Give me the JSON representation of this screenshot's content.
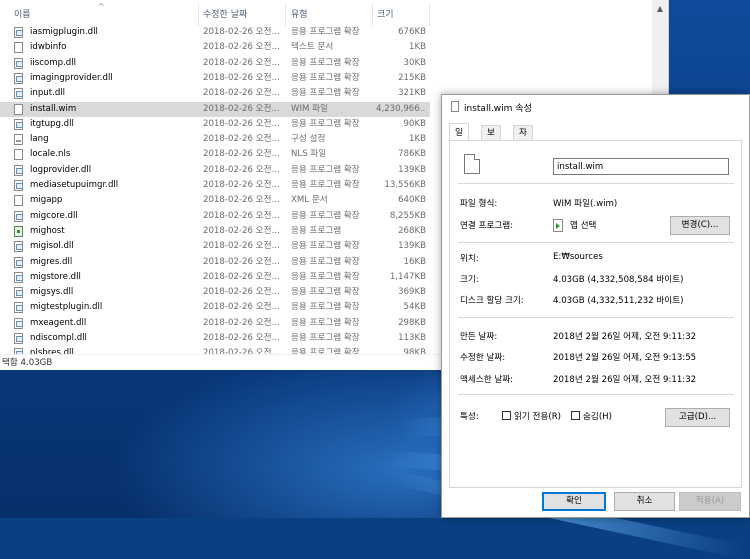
{
  "explorer": {
    "columns": {
      "name": "이름",
      "date": "수정한 날짜",
      "type": "유형",
      "size": "크기"
    },
    "rows": [
      {
        "name": "iasmigplugin.dll",
        "date": "2018-02-26 오전...",
        "type": "응용 프로그램 확장",
        "size": "676KB",
        "icon": "dll-file-icon"
      },
      {
        "name": "idwbinfo",
        "date": "2018-02-26 오전...",
        "type": "텍스트 문서",
        "size": "1KB",
        "icon": "text-file-icon"
      },
      {
        "name": "iiscomp.dll",
        "date": "2018-02-26 오전...",
        "type": "응용 프로그램 확장",
        "size": "30KB",
        "icon": "dll-file-icon"
      },
      {
        "name": "imagingprovider.dll",
        "date": "2018-02-26 오전...",
        "type": "응용 프로그램 확장",
        "size": "215KB",
        "icon": "dll-file-icon"
      },
      {
        "name": "input.dll",
        "date": "2018-02-26 오전...",
        "type": "응용 프로그램 확장",
        "size": "321KB",
        "icon": "dll-file-icon"
      },
      {
        "name": "install.wim",
        "date": "2018-02-26 오전...",
        "type": "WIM 파일",
        "size": "4,230,966...",
        "icon": "generic-file-icon",
        "selected": true
      },
      {
        "name": "itgtupg.dll",
        "date": "2018-02-26 오전...",
        "type": "응용 프로그램 확장",
        "size": "90KB",
        "icon": "dll-file-icon"
      },
      {
        "name": "lang",
        "date": "2018-02-26 오전...",
        "type": "구성 설정",
        "size": "1KB",
        "icon": "config-file-icon"
      },
      {
        "name": "locale.nls",
        "date": "2018-02-26 오전...",
        "type": "NLS 파일",
        "size": "786KB",
        "icon": "generic-file-icon"
      },
      {
        "name": "logprovider.dll",
        "date": "2018-02-26 오전...",
        "type": "응용 프로그램 확장",
        "size": "139KB",
        "icon": "dll-file-icon"
      },
      {
        "name": "mediasetupuimgr.dll",
        "date": "2018-02-26 오전...",
        "type": "응용 프로그램 확장",
        "size": "13,556KB",
        "icon": "dll-file-icon"
      },
      {
        "name": "migapp",
        "date": "2018-02-26 오전...",
        "type": "XML 문서",
        "size": "640KB",
        "icon": "xml-file-icon"
      },
      {
        "name": "migcore.dll",
        "date": "2018-02-26 오전...",
        "type": "응용 프로그램 확장",
        "size": "8,255KB",
        "icon": "dll-file-icon"
      },
      {
        "name": "mighost",
        "date": "2018-02-26 오전...",
        "type": "응용 프로그램",
        "size": "268KB",
        "icon": "exe-file-icon"
      },
      {
        "name": "migisol.dll",
        "date": "2018-02-26 오전...",
        "type": "응용 프로그램 확장",
        "size": "139KB",
        "icon": "dll-file-icon"
      },
      {
        "name": "migres.dll",
        "date": "2018-02-26 오전...",
        "type": "응용 프로그램 확장",
        "size": "16KB",
        "icon": "dll-file-icon"
      },
      {
        "name": "migstore.dll",
        "date": "2018-02-26 오전...",
        "type": "응용 프로그램 확장",
        "size": "1,147KB",
        "icon": "dll-file-icon"
      },
      {
        "name": "migsys.dll",
        "date": "2018-02-26 오전...",
        "type": "응용 프로그램 확장",
        "size": "369KB",
        "icon": "dll-file-icon"
      },
      {
        "name": "migtestplugin.dll",
        "date": "2018-02-26 오전...",
        "type": "응용 프로그램 확장",
        "size": "54KB",
        "icon": "dll-file-icon"
      },
      {
        "name": "mxeagent.dll",
        "date": "2018-02-26 오전...",
        "type": "응용 프로그램 확장",
        "size": "298KB",
        "icon": "dll-file-icon"
      },
      {
        "name": "ndiscompl.dll",
        "date": "2018-02-26 오전...",
        "type": "응용 프로그램 확장",
        "size": "113KB",
        "icon": "dll-file-icon"
      },
      {
        "name": "nlsbres.dll",
        "date": "2018-02-26 오전...",
        "type": "응용 프로그램 확장",
        "size": "98KB",
        "icon": "dll-file-icon"
      }
    ],
    "status": "택함 4.03GB"
  },
  "dialog": {
    "title": "install.wim 속성",
    "tabs": [
      {
        "label": "일반",
        "active": true
      },
      {
        "label": "보안",
        "active": false
      },
      {
        "label": "자세히",
        "active": false
      }
    ],
    "filename": "install.wim",
    "file_type_label": "파일 형식:",
    "file_type_value": "WIM 파일(.wim)",
    "opens_with_label": "연결 프로그램:",
    "opens_with_value": "앱 선택",
    "change_button": "변경(C)...",
    "location_label": "위치:",
    "location_value": "E:₩sources",
    "size_label": "크기:",
    "size_value": "4.03GB (4,332,508,584 바이트)",
    "disk_size_label": "디스크 할당 크기:",
    "disk_size_value": "4.03GB (4,332,511,232 바이트)",
    "created_label": "만든 날짜:",
    "created_value": "2018년 2월 26일 어제, 오전 9:11:32",
    "modified_label": "수정한 날짜:",
    "modified_value": "2018년 2월 26일 어제, 오전 9:13:55",
    "accessed_label": "액세스한 날짜:",
    "accessed_value": "2018년 2월 26일 어제, 오전 9:11:32",
    "attributes_label": "특성:",
    "readonly_label": "읽기 전용(R)",
    "hidden_label": "숨김(H)",
    "advanced_button": "고급(D)...",
    "ok_button": "확인",
    "cancel_button": "취소",
    "apply_button": "적용(A)"
  },
  "colors": {
    "selection": "#d9d9d9",
    "accent": "#0078d7",
    "desktop": "#0a3c82"
  }
}
